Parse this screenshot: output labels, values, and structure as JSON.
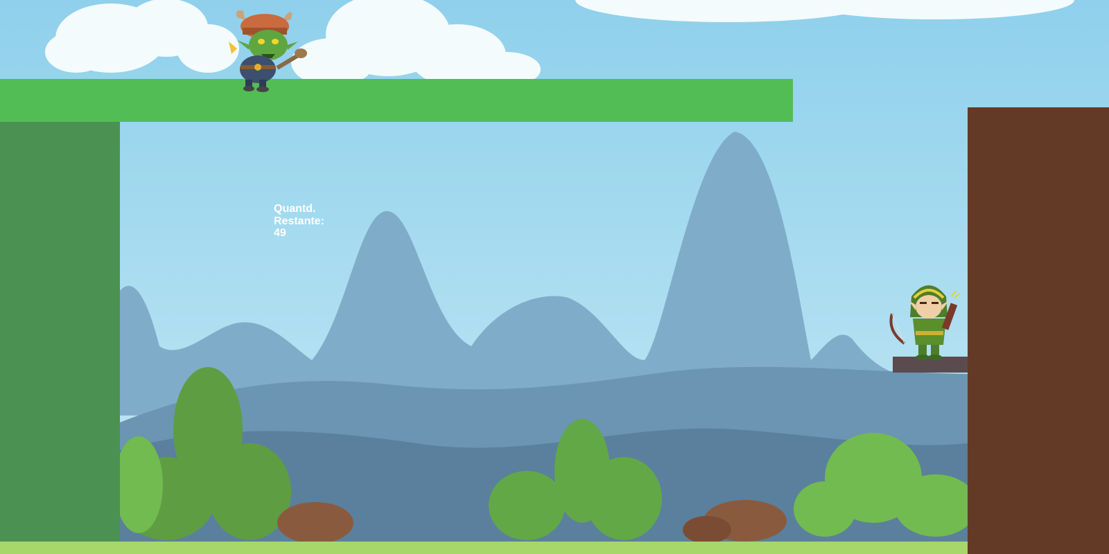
{
  "game": {
    "hud": {
      "remaining_label": "Quantd.\nRestante:",
      "remaining_value": 49,
      "remaining_text": "Quantd.\nRestante:\n49"
    },
    "characters": {
      "enemy": "goblin-warrior",
      "player": "elf-archer"
    },
    "colors": {
      "sky": "#a9dcef",
      "platform_top": "#52bd55",
      "wall_left": "#4b9152",
      "wall_right": "#633a26",
      "ledge": "#5a4b4e",
      "grass": "#a7d66a"
    }
  }
}
